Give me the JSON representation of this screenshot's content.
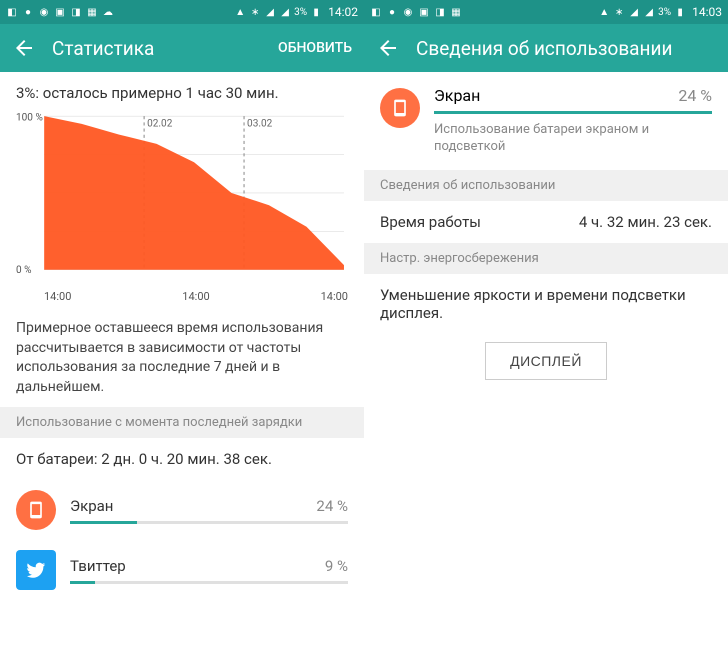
{
  "left": {
    "status": {
      "battery": "3%",
      "time": "14:02"
    },
    "title": "Статистика",
    "action": "ОБНОВИТЬ",
    "summary": "3%: осталось примерно 1 час 30 мин.",
    "chart_data": {
      "type": "area",
      "x": [
        0,
        6,
        12,
        18,
        24,
        30,
        36,
        42,
        48
      ],
      "values": [
        100,
        95,
        88,
        82,
        70,
        50,
        42,
        28,
        3
      ],
      "ylim": [
        0,
        100
      ],
      "ylabel_top": "100 %",
      "ylabel_bottom": "0 %",
      "xticks": [
        "14:00",
        "14:00",
        "14:00"
      ],
      "markers": [
        "02.02",
        "03.02"
      ]
    },
    "explanation": "Примерное оставшееся время использования рассчитывается в зависимости от частоты использования за последние 7 дней и в дальнейшем.",
    "section_since_charge": "Использование с момента последней зарядки",
    "battery_time": "От батареи: 2 дн. 0 ч. 20 мин. 38 сек.",
    "usage": [
      {
        "name": "Экран",
        "pct": "24 %",
        "pct_num": 24,
        "icon": "screen-icon"
      },
      {
        "name": "Твиттер",
        "pct": "9 %",
        "pct_num": 9,
        "icon": "twitter-icon"
      }
    ]
  },
  "right": {
    "status": {
      "battery": "3%",
      "time": "14:03"
    },
    "title": "Сведения об использовании",
    "detail": {
      "name": "Экран",
      "pct": "24 %",
      "desc": "Использование батареи экраном и подсветкой"
    },
    "section_usage": "Сведения об использовании",
    "runtime_label": "Время работы",
    "runtime_value": "4 ч. 32 мин. 23 сек.",
    "section_power": "Настр. энергосбережения",
    "power_desc": "Уменьшение яркости и времени подсветки дисплея.",
    "button": "ДИСПЛЕЙ"
  }
}
